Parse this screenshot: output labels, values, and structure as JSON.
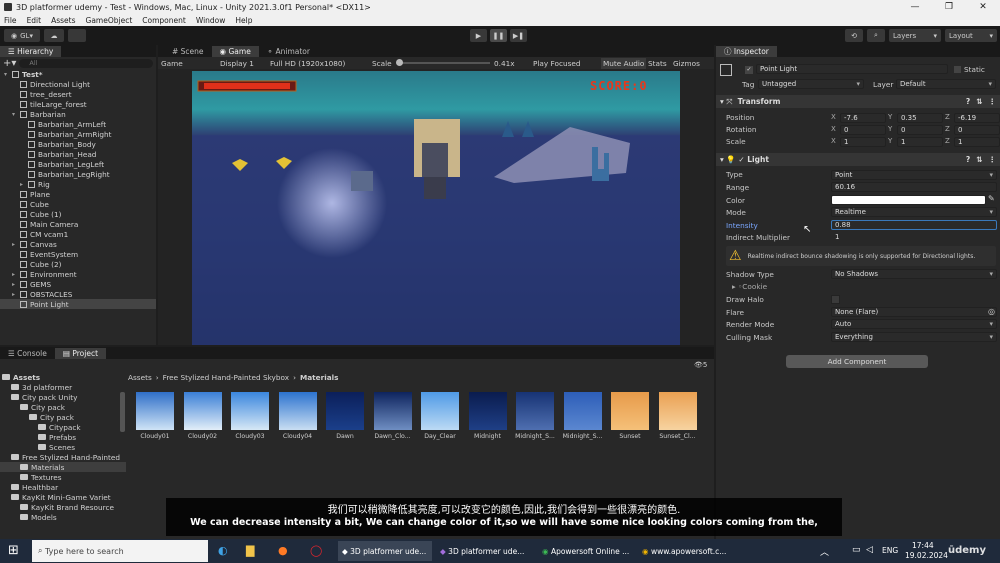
{
  "window": {
    "title": "3D platformer udemy - Test - Windows, Mac, Linux - Unity 2021.3.0f1 Personal* <DX11>"
  },
  "menu": [
    "File",
    "Edit",
    "Assets",
    "GameObject",
    "Component",
    "Window",
    "Help"
  ],
  "toolbar": {
    "account": "GL",
    "layers": "Layers",
    "layout": "Layout"
  },
  "hierarchy": {
    "tab": "Hierarchy",
    "search_placeholder": "All",
    "items": [
      {
        "label": "Test*",
        "depth": 0,
        "arrow": "▾",
        "kind": "scene"
      },
      {
        "label": "Directional Light",
        "depth": 1
      },
      {
        "label": "tree_desert",
        "depth": 1
      },
      {
        "label": "tileLarge_forest",
        "depth": 1
      },
      {
        "label": "Barbarian",
        "depth": 1,
        "arrow": "▾"
      },
      {
        "label": "Barbarian_ArmLeft",
        "depth": 2
      },
      {
        "label": "Barbarian_ArmRight",
        "depth": 2
      },
      {
        "label": "Barbarian_Body",
        "depth": 2
      },
      {
        "label": "Barbarian_Head",
        "depth": 2
      },
      {
        "label": "Barbarian_LegLeft",
        "depth": 2
      },
      {
        "label": "Barbarian_LegRight",
        "depth": 2
      },
      {
        "label": "Rig",
        "depth": 2,
        "arrow": "▸"
      },
      {
        "label": "Plane",
        "depth": 1
      },
      {
        "label": "Cube",
        "depth": 1
      },
      {
        "label": "Cube (1)",
        "depth": 1
      },
      {
        "label": "Main Camera",
        "depth": 1
      },
      {
        "label": "CM vcam1",
        "depth": 1
      },
      {
        "label": "Canvas",
        "depth": 1,
        "arrow": "▸"
      },
      {
        "label": "EventSystem",
        "depth": 1
      },
      {
        "label": "Cube (2)",
        "depth": 1
      },
      {
        "label": "Environment",
        "depth": 1,
        "arrow": "▸"
      },
      {
        "label": "GEMS",
        "depth": 1,
        "arrow": "▸"
      },
      {
        "label": "OBSTACLES",
        "depth": 1,
        "arrow": "▸"
      },
      {
        "label": "Point Light",
        "depth": 1,
        "selected": true
      }
    ]
  },
  "view": {
    "tabs": [
      "Scene",
      "Game",
      "Animator"
    ],
    "game_bar": {
      "mode": "Game",
      "display": "Display 1",
      "resolution": "Full HD (1920x1080)",
      "scale_label": "Scale",
      "scale_value": "0.41x",
      "play_focused": "Play Focused",
      "mute": "Mute Audio",
      "stats": "Stats",
      "gizmos": "Gizmos"
    },
    "score": "SCORE:0"
  },
  "inspector": {
    "tab": "Inspector",
    "object_name": "Point Light",
    "static_label": "Static",
    "tag_label": "Tag",
    "tag_value": "Untagged",
    "layer_label": "Layer",
    "layer_value": "Default",
    "transform": {
      "title": "Transform",
      "position": {
        "label": "Position",
        "x": "-7.6",
        "y": "0.35",
        "z": "-6.19"
      },
      "rotation": {
        "label": "Rotation",
        "x": "0",
        "y": "0",
        "z": "0"
      },
      "scale": {
        "label": "Scale",
        "x": "1",
        "y": "1",
        "z": "1"
      }
    },
    "light": {
      "title": "Light",
      "type_label": "Type",
      "type_value": "Point",
      "range_label": "Range",
      "range_value": "60.16",
      "color_label": "Color",
      "color_value": "#ffffff",
      "mode_label": "Mode",
      "mode_value": "Realtime",
      "intensity_label": "Intensity",
      "intensity_value": "0.88",
      "indirect_label": "Indirect Multiplier",
      "indirect_value": "1",
      "warning": "Realtime indirect bounce shadowing is only supported for Directional lights.",
      "shadow_label": "Shadow Type",
      "shadow_value": "No Shadows",
      "cookie_label": "Cookie",
      "halo_label": "Draw Halo",
      "flare_label": "Flare",
      "flare_value": "None (Flare)",
      "render_label": "Render Mode",
      "render_value": "Auto",
      "culling_label": "Culling Mask",
      "culling_value": "Everything"
    },
    "add_component": "Add Component"
  },
  "project": {
    "tabs": [
      "Console",
      "Project"
    ],
    "tree": [
      {
        "label": "Assets",
        "depth": 0,
        "bold": true
      },
      {
        "label": "3d platformer",
        "depth": 1
      },
      {
        "label": "City pack Unity",
        "depth": 1
      },
      {
        "label": "City pack",
        "depth": 2
      },
      {
        "label": "City pack",
        "depth": 3
      },
      {
        "label": "Citypack",
        "depth": 4
      },
      {
        "label": "Prefabs",
        "depth": 4
      },
      {
        "label": "Scenes",
        "depth": 4
      },
      {
        "label": "Free Stylized Hand-Painted",
        "depth": 1
      },
      {
        "label": "Materials",
        "depth": 2,
        "selected": true
      },
      {
        "label": "Textures",
        "depth": 2
      },
      {
        "label": "Healthbar",
        "depth": 1
      },
      {
        "label": "KayKit Mini-Game Variet",
        "depth": 1
      },
      {
        "label": "KayKit Brand Resource",
        "depth": 2
      },
      {
        "label": "Models",
        "depth": 2
      }
    ],
    "breadcrumb": [
      "Assets",
      "Free Stylized Hand-Painted Skybox",
      "Materials"
    ],
    "count": "5",
    "assets": [
      {
        "name": "Cloudy01",
        "top": "#2f6fc8",
        "bottom": "#cfe4f6"
      },
      {
        "name": "Cloudy02",
        "top": "#3a7fd6",
        "bottom": "#e2eef8"
      },
      {
        "name": "Cloudy03",
        "top": "#3a86de",
        "bottom": "#d6e8f5"
      },
      {
        "name": "Cloudy04",
        "top": "#2c73cf",
        "bottom": "#c9def2"
      },
      {
        "name": "Dawn",
        "top": "#0b1f5a",
        "bottom": "#1b3f8a"
      },
      {
        "name": "Dawn_Clo...",
        "top": "#0e245e",
        "bottom": "#6f8ec2"
      },
      {
        "name": "Day_Clear",
        "top": "#4f9ae6",
        "bottom": "#bcdaf4"
      },
      {
        "name": "Midnight",
        "top": "#0a1c4e",
        "bottom": "#1f3f86"
      },
      {
        "name": "Midnight_S...",
        "top": "#173374",
        "bottom": "#4f6fb0"
      },
      {
        "name": "Midnight_S...",
        "top": "#2d5eb8",
        "bottom": "#5b87d0"
      },
      {
        "name": "Sunset",
        "top": "#e79a4a",
        "bottom": "#f5c079"
      },
      {
        "name": "Sunset_Cl...",
        "top": "#eaa052",
        "bottom": "#f7d3a0"
      }
    ]
  },
  "subtitles": {
    "zh": "我们可以稍微降低其亮度,可以改变它的颜色,因此,我们会得到一些很漂亮的颜色.",
    "en": "We can decrease intensity a bit, We can change color of it,so we will have some nice looking colors coming from the,"
  },
  "taskbar": {
    "search_placeholder": "Type here to search",
    "apps": [
      "3D platformer ude...",
      "3D platformer ude...",
      "Apowersoft Online ...",
      "www.apowersoft.c..."
    ],
    "lang": "ENG",
    "time": "17:44",
    "date": "19.02.2024"
  },
  "watermark": "ūdemy"
}
